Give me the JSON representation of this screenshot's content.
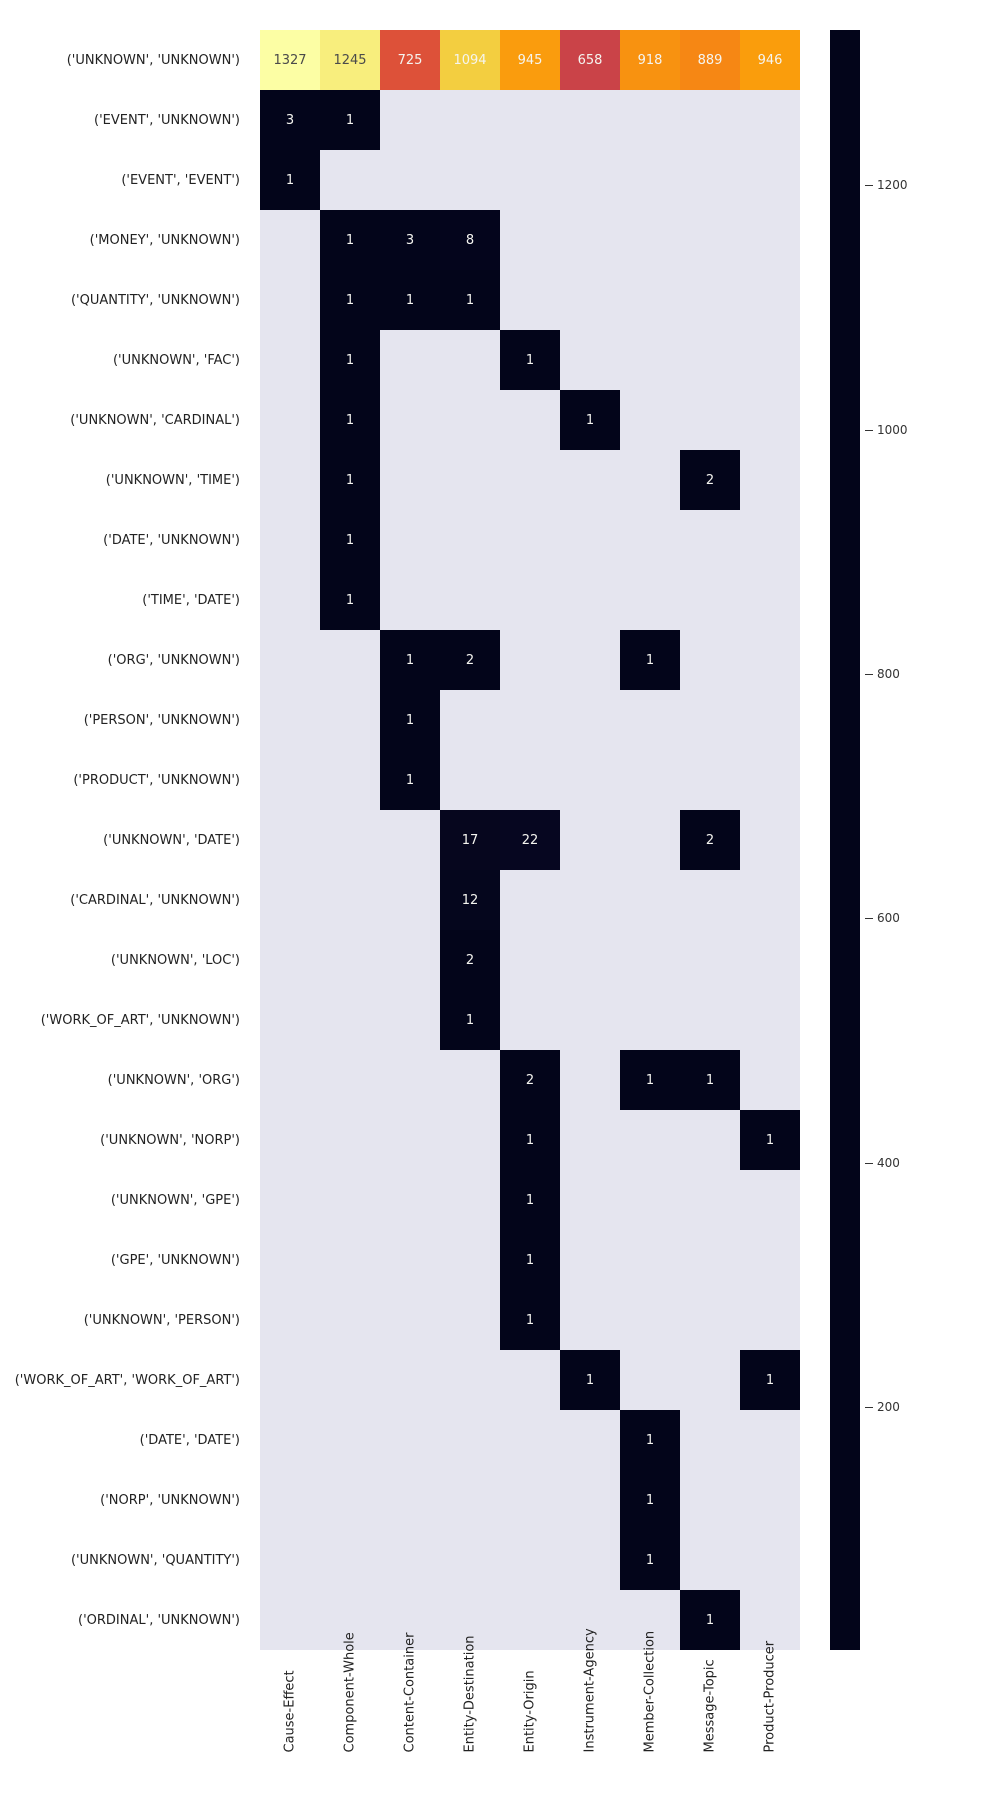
{
  "chart_data": {
    "type": "heatmap",
    "title": "",
    "xlabel": "",
    "ylabel": "",
    "ylabels": [
      "('UNKNOWN', 'UNKNOWN')",
      "('EVENT', 'UNKNOWN')",
      "('EVENT', 'EVENT')",
      "('MONEY', 'UNKNOWN')",
      "('QUANTITY', 'UNKNOWN')",
      "('UNKNOWN', 'FAC')",
      "('UNKNOWN', 'CARDINAL')",
      "('UNKNOWN', 'TIME')",
      "('DATE', 'UNKNOWN')",
      "('TIME', 'DATE')",
      "('ORG', 'UNKNOWN')",
      "('PERSON', 'UNKNOWN')",
      "('PRODUCT', 'UNKNOWN')",
      "('UNKNOWN', 'DATE')",
      "('CARDINAL', 'UNKNOWN')",
      "('UNKNOWN', 'LOC')",
      "('WORK_OF_ART', 'UNKNOWN')",
      "('UNKNOWN', 'ORG')",
      "('UNKNOWN', 'NORP')",
      "('UNKNOWN', 'GPE')",
      "('GPE', 'UNKNOWN')",
      "('UNKNOWN', 'PERSON')",
      "('WORK_OF_ART', 'WORK_OF_ART')",
      "('DATE', 'DATE')",
      "('NORP', 'UNKNOWN')",
      "('UNKNOWN', 'QUANTITY')",
      "('ORDINAL', 'UNKNOWN')"
    ],
    "xlabels": [
      "Cause-Effect",
      "Component-Whole",
      "Content-Container",
      "Entity-Destination",
      "Entity-Origin",
      "Instrument-Agency",
      "Member-Collection",
      "Message-Topic",
      "Product-Producer"
    ],
    "values": [
      [
        1327,
        1245,
        725,
        1094,
        945,
        658,
        918,
        889,
        946
      ],
      [
        3,
        1,
        null,
        null,
        null,
        null,
        null,
        null,
        null
      ],
      [
        1,
        null,
        null,
        null,
        null,
        null,
        null,
        null,
        null
      ],
      [
        null,
        1,
        3,
        8,
        null,
        null,
        null,
        null,
        null
      ],
      [
        null,
        1,
        1,
        1,
        null,
        null,
        null,
        null,
        null
      ],
      [
        null,
        1,
        null,
        null,
        1,
        null,
        null,
        null,
        null
      ],
      [
        null,
        1,
        null,
        null,
        null,
        1,
        null,
        null,
        null
      ],
      [
        null,
        1,
        null,
        null,
        null,
        null,
        null,
        2,
        null
      ],
      [
        null,
        1,
        null,
        null,
        null,
        null,
        null,
        null,
        null
      ],
      [
        null,
        1,
        null,
        null,
        null,
        null,
        null,
        null,
        null
      ],
      [
        null,
        null,
        1,
        2,
        null,
        null,
        1,
        null,
        null
      ],
      [
        null,
        null,
        1,
        null,
        null,
        null,
        null,
        null,
        null
      ],
      [
        null,
        null,
        1,
        null,
        null,
        null,
        null,
        null,
        null
      ],
      [
        null,
        null,
        null,
        17,
        22,
        null,
        null,
        2,
        null
      ],
      [
        null,
        null,
        null,
        12,
        null,
        null,
        null,
        null,
        null
      ],
      [
        null,
        null,
        null,
        2,
        null,
        null,
        null,
        null,
        null
      ],
      [
        null,
        null,
        null,
        1,
        null,
        null,
        null,
        null,
        null
      ],
      [
        null,
        null,
        null,
        null,
        2,
        null,
        1,
        1,
        null
      ],
      [
        null,
        null,
        null,
        null,
        1,
        null,
        null,
        null,
        1
      ],
      [
        null,
        null,
        null,
        null,
        1,
        null,
        null,
        null,
        null
      ],
      [
        null,
        null,
        null,
        null,
        1,
        null,
        null,
        null,
        null
      ],
      [
        null,
        null,
        null,
        null,
        1,
        null,
        null,
        null,
        null
      ],
      [
        null,
        null,
        null,
        null,
        null,
        1,
        null,
        null,
        1
      ],
      [
        null,
        null,
        null,
        null,
        null,
        null,
        1,
        null,
        null
      ],
      [
        null,
        null,
        null,
        null,
        null,
        null,
        1,
        null,
        null
      ],
      [
        null,
        null,
        null,
        null,
        null,
        null,
        1,
        null,
        null
      ],
      [
        null,
        null,
        null,
        null,
        null,
        null,
        null,
        1,
        null
      ]
    ],
    "blank_color": "#e5e5ef",
    "colorbar": {
      "ticks": [
        200,
        400,
        600,
        800,
        1000,
        1200
      ],
      "vmin": 1,
      "vmax": 1327
    },
    "cmap_stops": [
      "#03051a",
      "#170b3b",
      "#410967",
      "#6b176e",
      "#932667",
      "#bb3754",
      "#dd5139",
      "#f37719",
      "#fba40a",
      "#f3cc3d",
      "#f6e76a",
      "#fcfea4"
    ]
  }
}
